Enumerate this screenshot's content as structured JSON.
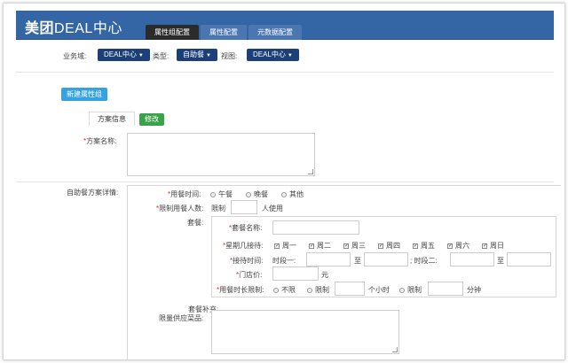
{
  "header": {
    "brand_bold": "美团",
    "brand_rest": "DEAL中心",
    "tabs": [
      {
        "label": "属性组配置",
        "active": true
      },
      {
        "label": "属性配置",
        "active": false
      },
      {
        "label": "元数据配置",
        "active": false
      }
    ]
  },
  "filters": {
    "business_label": "业务域:",
    "business_value": "DEAL中心",
    "category_label": "类型:",
    "category_value": "自助餐",
    "view_label": "视图:",
    "view_value": "DEAL中心"
  },
  "actions": {
    "new_group": "新建属性组"
  },
  "subtabs": {
    "plan_info": "方案信息",
    "edit": "修改"
  },
  "form": {
    "plan_name_label": "方案名称:",
    "detail_label": "自助餐方案详情:",
    "meal_time": {
      "label": "用餐时间:",
      "options": [
        "午餐",
        "晚餐",
        "其他"
      ]
    },
    "limit_people": {
      "label": "限制用餐人数:",
      "prefix": "限制",
      "suffix": "人使用"
    },
    "package_label": "套餐:",
    "package": {
      "name_label": "套餐名称:",
      "weekdays_label": "星期几接待:",
      "weekdays": [
        "周一",
        "周二",
        "周三",
        "周四",
        "周五",
        "周六",
        "周日"
      ],
      "reception_label": "接待时间:",
      "period1_label": "时段一:",
      "to1": "至",
      "period2_label": "; 时段二:",
      "to2": "至",
      "price_label": "门店价:",
      "price_unit": "元",
      "duration_label": "用餐时长限制:",
      "duration_options": [
        "不限",
        "限制",
        "限制"
      ],
      "hours_unit": "个小时",
      "minutes_unit": "分钟"
    },
    "supplement_label1": "套餐补充:",
    "supplement_label2": "限量供应菜品:"
  },
  "colors": {
    "header_bg": "#3465a4",
    "dropdown_bg": "#1b3f78",
    "new_button": "#36a3e0",
    "edit_button": "#3aa34a",
    "required": "#d9302a"
  }
}
